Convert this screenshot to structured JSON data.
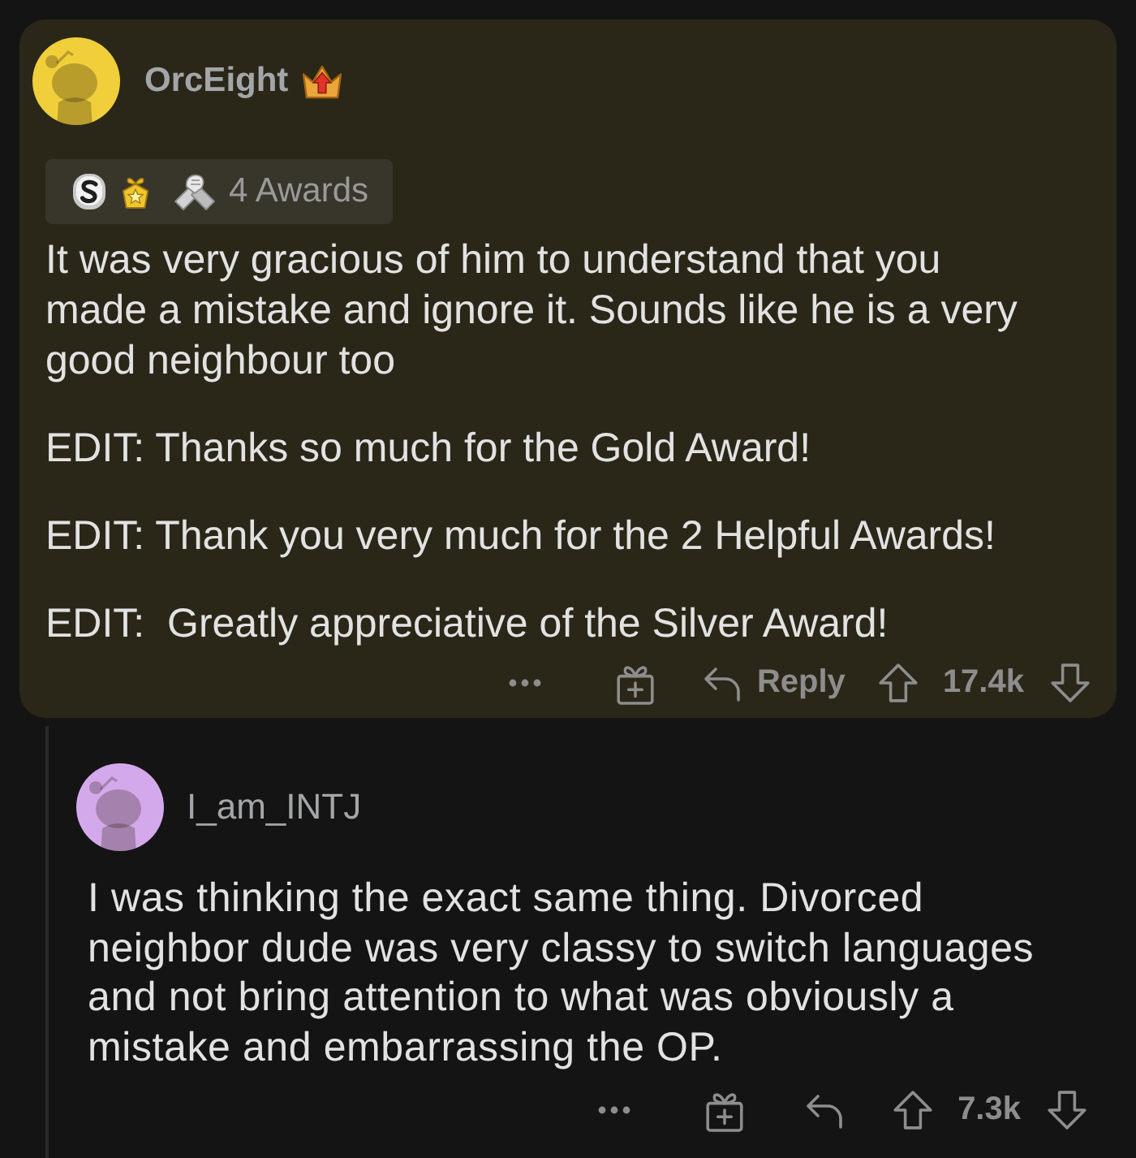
{
  "comments": [
    {
      "author": "OrcEight",
      "color": "#f0cf3a",
      "flair_badge": true,
      "awards": {
        "label": "4 Awards"
      },
      "paragraphs": [
        "It was very gracious of him to understand that you made a mistake and ignore it. Sounds like he is a very good neighbour too",
        "EDIT: Thanks so much for the Gold Award!",
        "EDIT: Thank you very much for the 2 Helpful Awards!",
        "EDIT:  Greatly appreciative of the Silver Award!"
      ],
      "actions": {
        "reply_label": "Reply",
        "score": "17.4k"
      },
      "children": [
        {
          "author": "I_am_INTJ",
          "color": "#d4a9ec",
          "flair_badge": false,
          "paragraphs": [
            "I was thinking the exact same thing. Divorced neighbor dude was very classy to switch languages and not bring attention to what was obviously a mistake and embarrassing the OP."
          ],
          "actions": {
            "score": "7.3k"
          }
        }
      ]
    }
  ]
}
